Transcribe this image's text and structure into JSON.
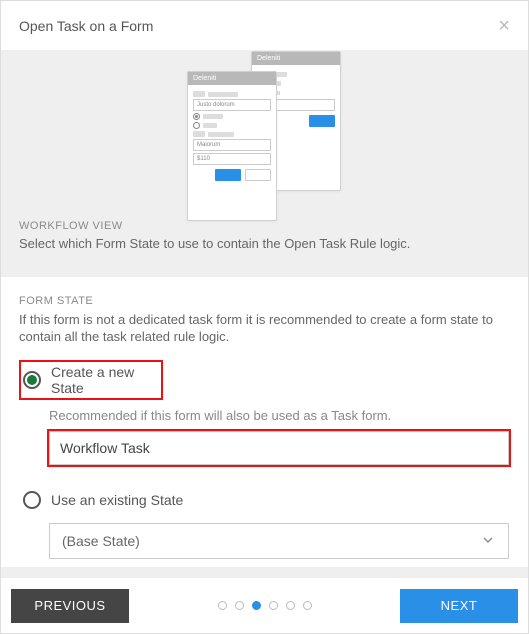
{
  "header": {
    "title": "Open Task on a Form"
  },
  "illustration": {
    "form_title": "Deleniti",
    "field1": "Justo dolorum",
    "field2": "Maiorum",
    "field3": "$110"
  },
  "workflow_view": {
    "label": "WORKFLOW VIEW",
    "desc": "Select which Form State to use to contain the Open Task Rule logic."
  },
  "form_state": {
    "label": "FORM STATE",
    "desc": "If this form is not a dedicated task form it is recommended to create a form state to contain all the task related rule logic.",
    "option_create": {
      "label": "Create a new State",
      "sub": "Recommended if this form will also be used as a Task form.",
      "value": "Workflow Task"
    },
    "option_existing": {
      "label": "Use an existing State",
      "selected": "(Base State)"
    }
  },
  "footer": {
    "prev": "PREVIOUS",
    "next": "NEXT",
    "steps": {
      "total": 6,
      "current": 3
    }
  }
}
